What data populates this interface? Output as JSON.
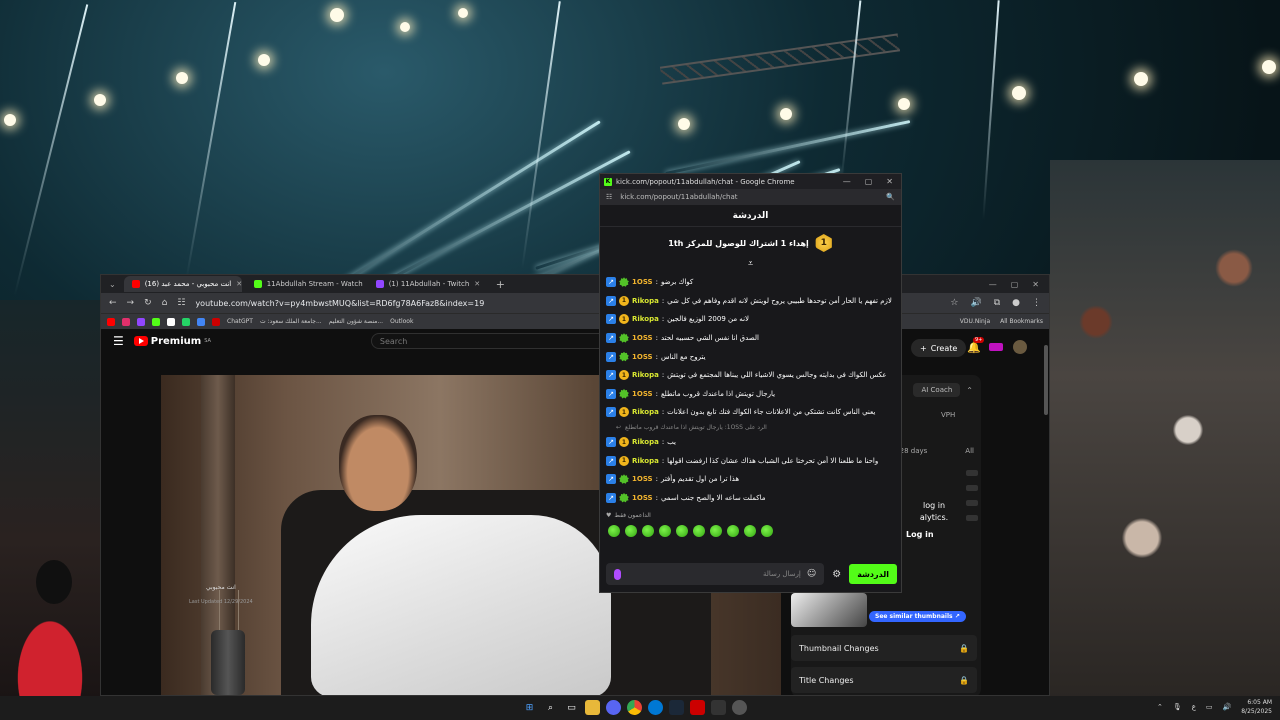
{
  "colors": {
    "kick_green": "#53fc18",
    "youtube_red": "#ff0000",
    "badge_blue": "#2b80e8",
    "badge_gold": "#f1b51c",
    "badge_green": "#53c228"
  },
  "kick_window": {
    "title": "kick.com/popout/11abdullah/chat - Google Chrome",
    "url": "kick.com/popout/11abdullah/chat",
    "chat_title": "الدردشة",
    "pinned_rank": "1",
    "pinned_text": "إهداء 1 اشتراك للوصول للمركز 1th",
    "messages": [
      {
        "user": "1OSS",
        "badge": "green",
        "text": "كواك برضو"
      },
      {
        "user": "Rikopa",
        "badge": "gold",
        "text": "لازم تفهم يا الحار أمن توحدها طبيبي يروح لويتش لانه اقدم وفاهم في كل شي"
      },
      {
        "user": "Rikopa",
        "badge": "gold",
        "text": "لانه من 2009 الوزيع فالجين"
      },
      {
        "user": "1OSS",
        "badge": "green",
        "text": "الصدق انا نفس الشي حسبيه لحتد"
      },
      {
        "user": "1OSS",
        "badge": "green",
        "text": "يتروح مع الناس"
      },
      {
        "user": "Rikopa",
        "badge": "gold",
        "text": "عكس الكواك في بدايته وجالس يسوي الاشياء اللي يبناها المجتمع في تويتش"
      },
      {
        "user": "1OSS",
        "badge": "green",
        "text": "يارجال تويتش اذا ماعندك قروب ماتطلع"
      },
      {
        "user": "Rikopa",
        "badge": "gold",
        "text": "يعني الناس كانت تشتكي من الاعلانات جاء الكواك فتك تابع بدون اعلانات"
      },
      {
        "user": "Rikopa",
        "badge": "gold",
        "text": "يب",
        "reply_to": "الرد على 1OSS: يارجال تويتش اذا ماعندك قروب ماتطلع"
      },
      {
        "user": "Rikopa",
        "badge": "gold",
        "text": "واحنا ما طلعنا الا أمن تحرختا على الشباب هذاك عشان كذا ارفضت اقولها"
      },
      {
        "user": "1OSS",
        "badge": "green",
        "text": "هذا ترا من اول تقديم وأفتر"
      },
      {
        "user": "1OSS",
        "badge": "green",
        "text": "ماكملت ساعه الا والصح جنب اسمي"
      }
    ],
    "pinned_label": "الداعمون فقط",
    "input_placeholder": "إرسال رسالة",
    "send_label": "الدردشة"
  },
  "yt_window": {
    "tabs": [
      {
        "label": "(16) انت محبوبي - محمد عبد",
        "active": true,
        "color": "#ff0000"
      },
      {
        "label": "11Abdullah Stream - Watch",
        "active": false,
        "color": "#53fc18"
      },
      {
        "label": "(1) 11Abdullah - Twitch",
        "active": false,
        "color": "#9146ff"
      }
    ],
    "url": "youtube.com/watch?v=py4mbwstMUQ&list=RD6fg78A6Faz8&index=19",
    "bookmarks": [
      "ChatGPT",
      "جامعة الملك سعود: ت...",
      "منصة شؤون التعليم...",
      "Outlook"
    ],
    "bookmarks_right": [
      "VDU.Ninja",
      "All Bookmarks"
    ],
    "logo": "Premium",
    "logo_region": "SA",
    "search_placeholder": "Search",
    "create_label": "Create",
    "notif_count": "9+",
    "side": {
      "ai_coach": "AI Coach",
      "vph": "VPH",
      "range_left": "st 28 days",
      "range_right": "All",
      "login_line1": "log in",
      "login_line2": "alytics.",
      "login_button": "Log in",
      "video_title": "انت محبوبي",
      "last_updated": "Last Updated 12/29/2024",
      "similar_button": "See similar thumbnails ↗",
      "sections": [
        "Thumbnail Changes",
        "Title Changes"
      ]
    }
  },
  "taskbar": {
    "time": "6:05 AM",
    "date": "8/25/2025",
    "lang": "ع"
  }
}
